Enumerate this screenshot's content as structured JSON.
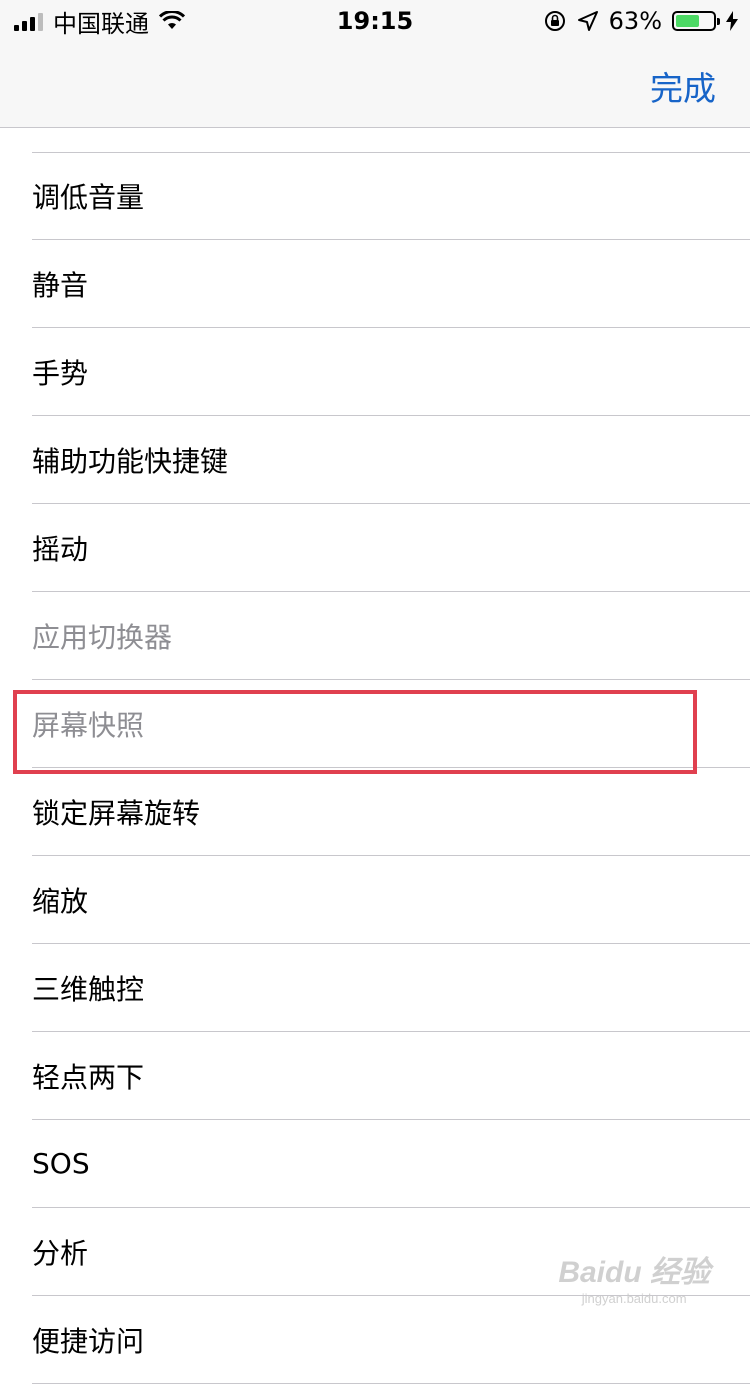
{
  "status_bar": {
    "carrier": "中国联通",
    "time": "19:15",
    "battery_percent": "63%",
    "battery_level": 0.63,
    "battery_color": "#4cd964"
  },
  "nav_bar": {
    "done_label": "完成",
    "accent_color": "#1764c8"
  },
  "list": {
    "items": [
      {
        "label": "调低音量",
        "enabled": true
      },
      {
        "label": "静音",
        "enabled": true
      },
      {
        "label": "手势",
        "enabled": true
      },
      {
        "label": "辅助功能快捷键",
        "enabled": true
      },
      {
        "label": "摇动",
        "enabled": true
      },
      {
        "label": "应用切换器",
        "enabled": false
      },
      {
        "label": "屏幕快照",
        "enabled": false,
        "highlighted": true
      },
      {
        "label": "锁定屏幕旋转",
        "enabled": true
      },
      {
        "label": "缩放",
        "enabled": true
      },
      {
        "label": "三维触控",
        "enabled": true
      },
      {
        "label": "轻点两下",
        "enabled": true
      },
      {
        "label": "SOS",
        "enabled": true
      },
      {
        "label": "分析",
        "enabled": true
      },
      {
        "label": "便捷访问",
        "enabled": true
      }
    ]
  },
  "annotation": {
    "highlight_color": "#e0404f"
  },
  "watermark": {
    "logo": "Baidu 经验",
    "url": "jingyan.baidu.com"
  }
}
